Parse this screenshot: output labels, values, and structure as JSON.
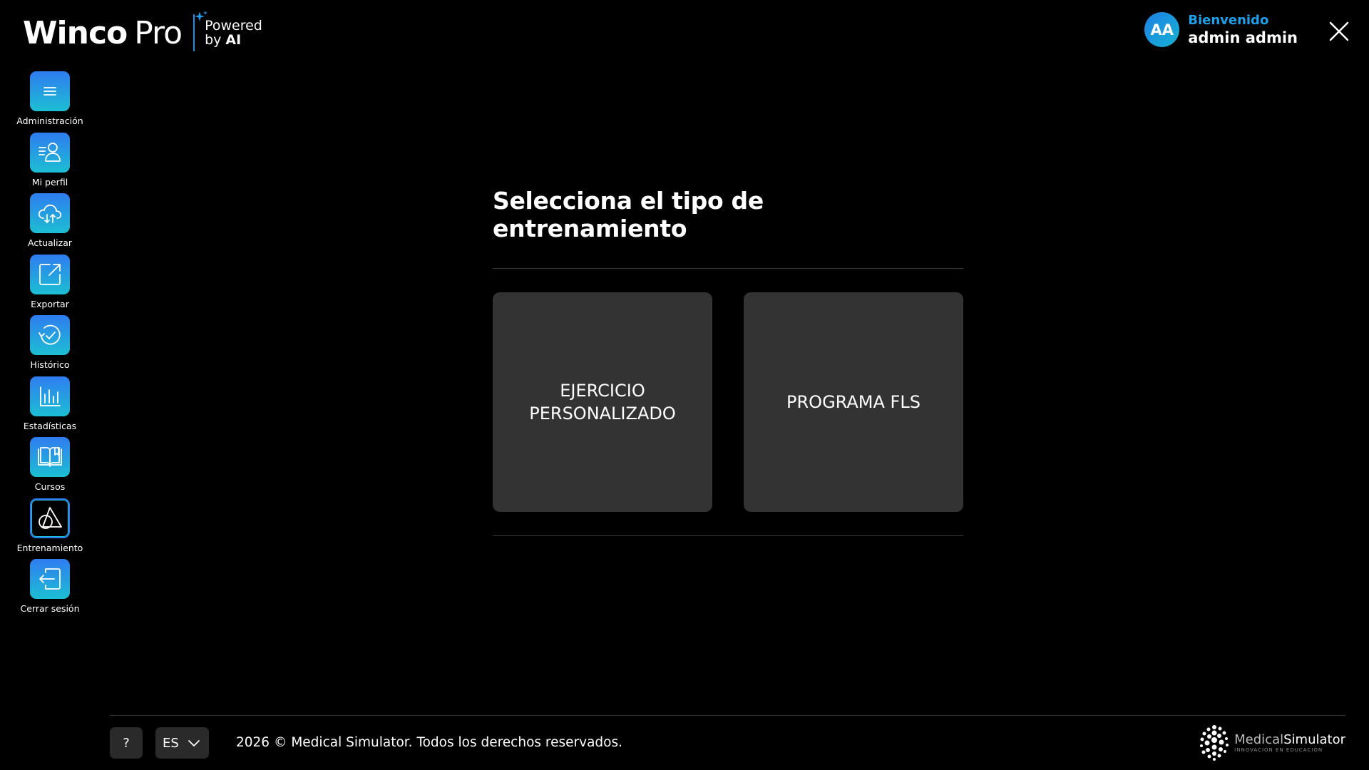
{
  "header": {
    "logo": {
      "brand": "Winco",
      "product": "Pro",
      "powered_line1": "Powered",
      "powered_line2_prefix": "by",
      "powered_line2_strong": "AI"
    },
    "user": {
      "initials": "AA",
      "welcome": "Bienvenido",
      "name": "admin admin"
    },
    "close_icon": "close-icon"
  },
  "sidebar": {
    "items": [
      {
        "label": "Administración",
        "icon": "menu-icon",
        "active": false
      },
      {
        "label": "Mi perfil",
        "icon": "profile-icon",
        "active": false
      },
      {
        "label": "Actualizar",
        "icon": "cloud-sync-icon",
        "active": false
      },
      {
        "label": "Exportar",
        "icon": "export-icon",
        "active": false
      },
      {
        "label": "Histórico",
        "icon": "history-icon",
        "active": false
      },
      {
        "label": "Estadísticas",
        "icon": "bar-chart-icon",
        "active": false
      },
      {
        "label": "Cursos",
        "icon": "book-icon",
        "active": false
      },
      {
        "label": "Entrenamiento",
        "icon": "shapes-icon",
        "active": true
      },
      {
        "label": "Cerrar sesión",
        "icon": "logout-icon",
        "active": false
      }
    ]
  },
  "main": {
    "title": "Selecciona el tipo de entrenamiento",
    "cards": [
      {
        "label": "EJERCICIO PERSONALIZADO"
      },
      {
        "label": "PROGRAMA FLS"
      }
    ]
  },
  "footer": {
    "help_label": "?",
    "language": "ES",
    "copyright": "2026 © Medical Simulator. Todos los derechos reservados.",
    "brand_light": "Medical",
    "brand_strong": "Simulator",
    "brand_tagline": "INNOVACIÓN EN EDUCACIÓN"
  },
  "colors": {
    "accent": "#1e90e8",
    "gradient_start": "#2f7cf0",
    "gradient_end": "#1cbfd3",
    "card_bg": "#333333",
    "background": "#000000"
  }
}
